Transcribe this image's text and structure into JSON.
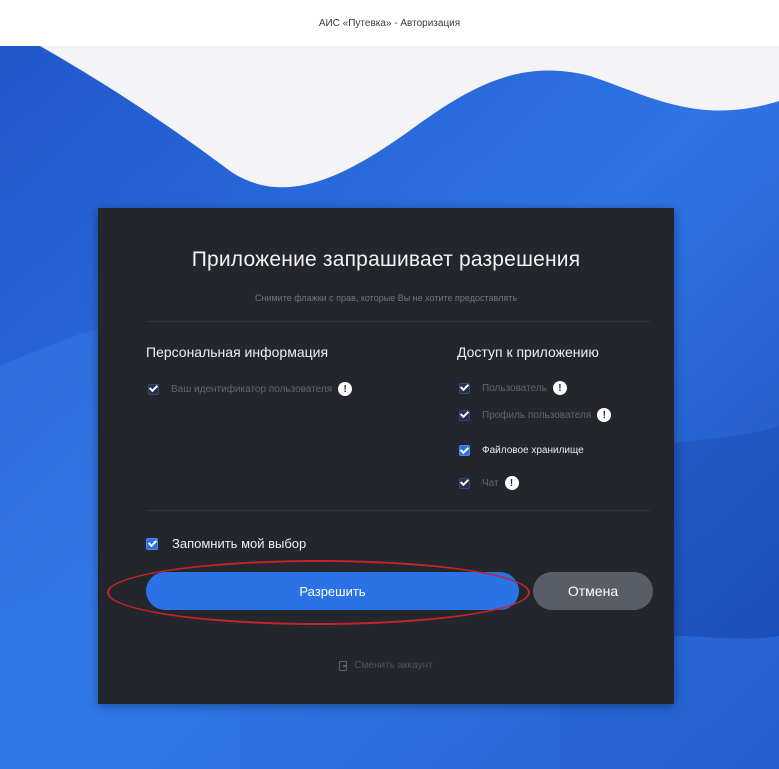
{
  "window": {
    "title": "АИС «Путевка» - Авторизация"
  },
  "dialog": {
    "title": "Приложение запрашивает разрешения",
    "subtitle": "Снимите флажки с прав, которые Вы не хотите предоставлять",
    "personal": {
      "title": "Персональная информация",
      "items": [
        {
          "label": "Ваш идентификатор пользователя",
          "checked": true,
          "enabled": false,
          "has_info": true
        }
      ]
    },
    "app_access": {
      "title": "Доступ к приложению",
      "items": [
        {
          "label": "Пользователь",
          "checked": true,
          "enabled": false,
          "has_info": true
        },
        {
          "label": "Профиль пользователя",
          "checked": true,
          "enabled": false,
          "has_info": true
        },
        {
          "label": "Файловое хранилище",
          "checked": true,
          "enabled": true,
          "has_info": false
        },
        {
          "label": "Чат",
          "checked": true,
          "enabled": false,
          "has_info": true
        }
      ]
    },
    "remember_label": "Запомнить мой выбор",
    "remember_checked": true,
    "allow_label": "Разрешить",
    "cancel_label": "Отмена",
    "signout_label": "Сменить аккаунт",
    "info_glyph": "!"
  },
  "colors": {
    "accent": "#2b72e6",
    "panel": "#23262d",
    "highlight": "#c5232c"
  },
  "icons": {
    "info": "info-icon",
    "check": "checkbox-check-icon",
    "signout": "door-exit-icon"
  }
}
